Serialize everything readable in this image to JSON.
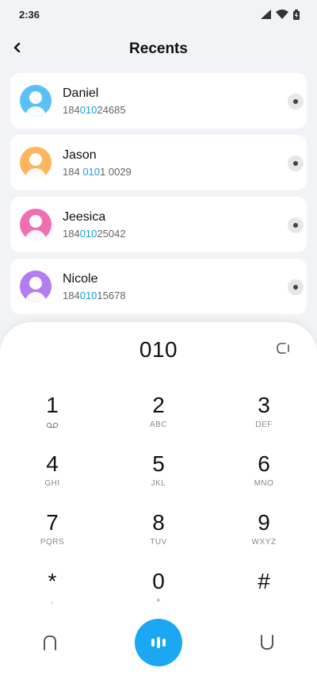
{
  "status_bar": {
    "time": "2:36",
    "icons": [
      "signal-icon",
      "wifi-icon",
      "battery-icon"
    ]
  },
  "header": {
    "title": "Recents",
    "back_icon": "back-arrow-icon"
  },
  "contacts": [
    {
      "name": "Daniel",
      "number_pre": "184",
      "number_match": "010",
      "number_post": "24685",
      "avatar_color": "#5bc0f8"
    },
    {
      "name": "Jason",
      "number_pre": "184 ",
      "number_match": "010",
      "number_post": "1 0029",
      "avatar_color": "#ffb45e"
    },
    {
      "name": "Jeesica",
      "number_pre": "184",
      "number_match": "010",
      "number_post": "25042",
      "avatar_color": "#f06fb0"
    },
    {
      "name": "Nicole",
      "number_pre": "184",
      "number_match": "010",
      "number_post": "15678",
      "avatar_color": "#b57cf0"
    }
  ],
  "dialer": {
    "input": "010",
    "keys": [
      {
        "digit": "1",
        "letters": ""
      },
      {
        "digit": "2",
        "letters": "ABC"
      },
      {
        "digit": "3",
        "letters": "DEF"
      },
      {
        "digit": "4",
        "letters": "GHI"
      },
      {
        "digit": "5",
        "letters": "JKL"
      },
      {
        "digit": "6",
        "letters": "MNO"
      },
      {
        "digit": "7",
        "letters": "PQRS"
      },
      {
        "digit": "8",
        "letters": "TUV"
      },
      {
        "digit": "9",
        "letters": "WXYZ"
      },
      {
        "digit": "*",
        "letters": ","
      },
      {
        "digit": "0",
        "letters": "+"
      },
      {
        "digit": "#",
        "letters": ""
      }
    ],
    "voicemail_icon": "voicemail-icon",
    "call_color": "#1ba7f2"
  }
}
